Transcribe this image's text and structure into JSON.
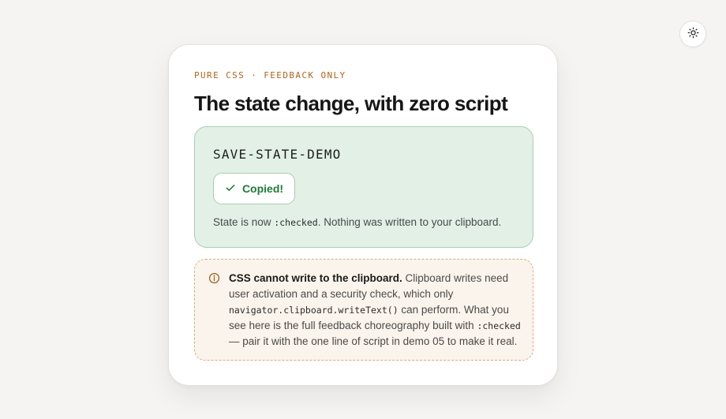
{
  "theme_toggle": {
    "icon": "sun-icon"
  },
  "card": {
    "eyebrow": "PURE CSS · FEEDBACK ONLY",
    "title": "The state change, with zero script"
  },
  "demo": {
    "key": "SAVE-STATE-DEMO",
    "button_label": "Copied!",
    "button_icon": "check-icon",
    "state_prefix": "State is now ",
    "state_code": ":checked",
    "state_suffix": ". Nothing was written to your clipboard."
  },
  "note": {
    "icon": "info-icon",
    "strong": "CSS cannot write to the clipboard.",
    "text_1": " Clipboard writes need user activation and a security check, which only ",
    "code_1": "navigator.clipboard.writeText()",
    "text_2": " can perform. What you see here is the full feedback choreography built with ",
    "code_2": ":checked",
    "text_3": " — pair it with the one line of script in demo 05 to make it real."
  },
  "colors": {
    "accent_amber": "#b0651b",
    "success_green": "#1f7a36",
    "demo_bg": "#e2f0e6",
    "note_bg": "#fbf4ec"
  }
}
